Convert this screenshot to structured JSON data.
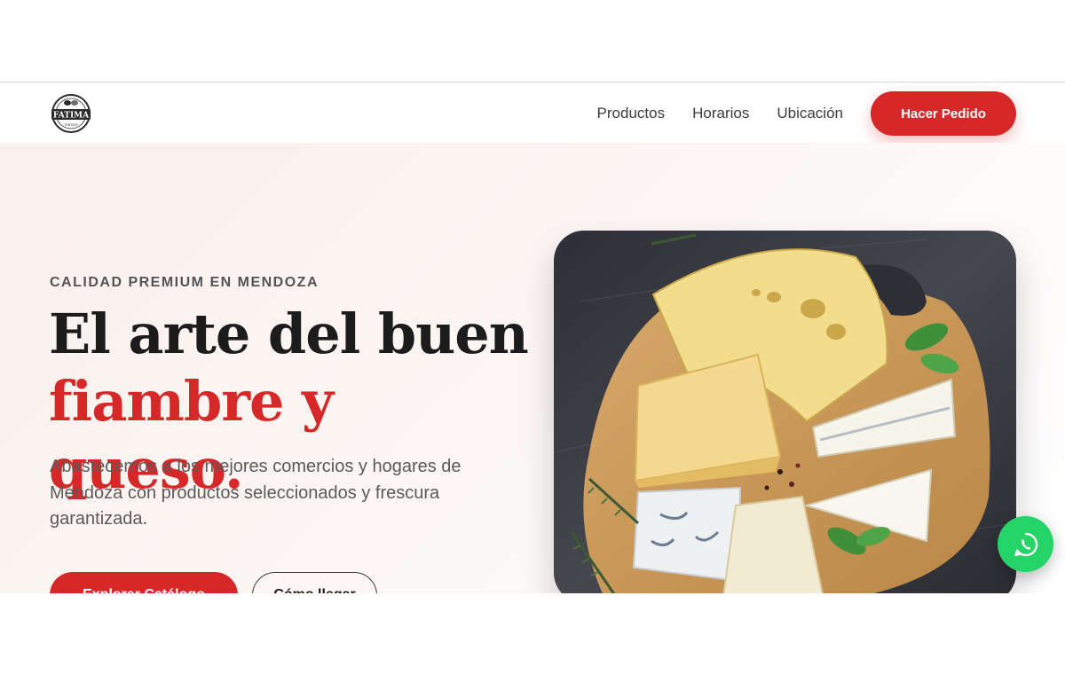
{
  "brand": {
    "logo_name": "FATIMA",
    "logo_top_text": "DISTRIBUIDORA",
    "logo_bottom_text": "TENTATE"
  },
  "nav": {
    "items": [
      {
        "label": "Productos"
      },
      {
        "label": "Horarios"
      },
      {
        "label": "Ubicación"
      }
    ],
    "cta_label": "Hacer Pedido"
  },
  "hero": {
    "eyebrow": "CALIDAD PREMIUM EN MENDOZA",
    "headline_line1": "El arte del buen",
    "headline_line2": "fiambre y queso.",
    "description": "Abastecemos a los mejores comercios y hogares de Mendoza con productos seleccionados y frescura garantizada.",
    "primary_button": "Explorar Catálogo",
    "secondary_button": "Cómo llegar"
  },
  "image": {
    "subject": "cheese-board-photo"
  },
  "floating": {
    "icon": "whatsapp-icon"
  },
  "colors": {
    "accent": "#d62828",
    "whatsapp": "#25d366",
    "heading": "#1c1c1c",
    "body_text": "#5a5a5a"
  }
}
